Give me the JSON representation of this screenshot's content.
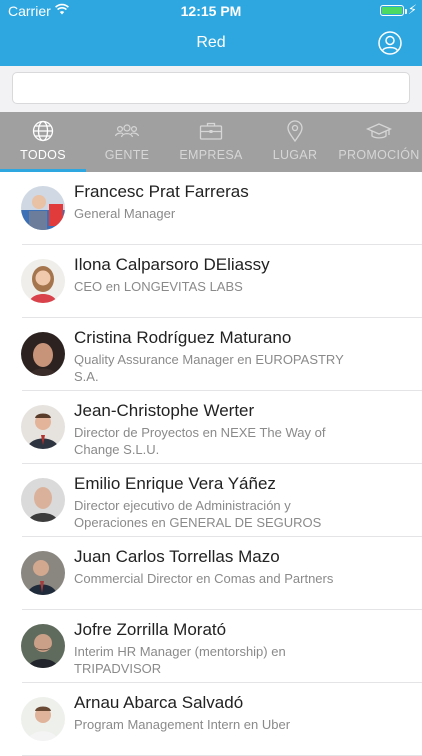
{
  "status_bar": {
    "carrier": "Carrier",
    "time": "12:15 PM",
    "battery_level": 1.0
  },
  "nav": {
    "title": "Red",
    "profile_icon": "user-circle-icon"
  },
  "search": {
    "value": "",
    "placeholder": ""
  },
  "tabs": [
    {
      "label": "TODOS",
      "icon": "globe-icon",
      "active": true
    },
    {
      "label": "GENTE",
      "icon": "people-icon",
      "active": false
    },
    {
      "label": "EMPRESA",
      "icon": "briefcase-icon",
      "active": false
    },
    {
      "label": "LUGAR",
      "icon": "map-pin-icon",
      "active": false
    },
    {
      "label": "PROMOCIÓN",
      "icon": "graduation-cap-icon",
      "active": false
    }
  ],
  "people": [
    {
      "name": "Francesc Prat Farreras",
      "role": "General Manager"
    },
    {
      "name": "Ilona Calparsoro DEliassy",
      "role": "CEO en LONGEVITAS LABS"
    },
    {
      "name": "Cristina Rodríguez Maturano",
      "role": "Quality Assurance Manager en EUROPASTRY S.A."
    },
    {
      "name": "Jean-Christophe Werter",
      "role": "Director de Proyectos en NEXE The Way of Change S.L.U."
    },
    {
      "name": "Emilio Enrique Vera Yáñez",
      "role": "Director ejecutivo de Administración y Operaciones en GENERAL DE SEGUROS"
    },
    {
      "name": "Juan Carlos Torrellas Mazo",
      "role": "Commercial Director  en Comas and Partners"
    },
    {
      "name": "Jofre Zorrilla Morató",
      "role": "Interim HR Manager (mentorship) en TRIPADVISOR"
    },
    {
      "name": "Arnau Abarca Salvadó",
      "role": "Program Management Intern en Uber"
    }
  ],
  "colors": {
    "brand": "#2ea7e0",
    "tab_bar": "#a0a0a0",
    "battery": "#4cd964"
  }
}
